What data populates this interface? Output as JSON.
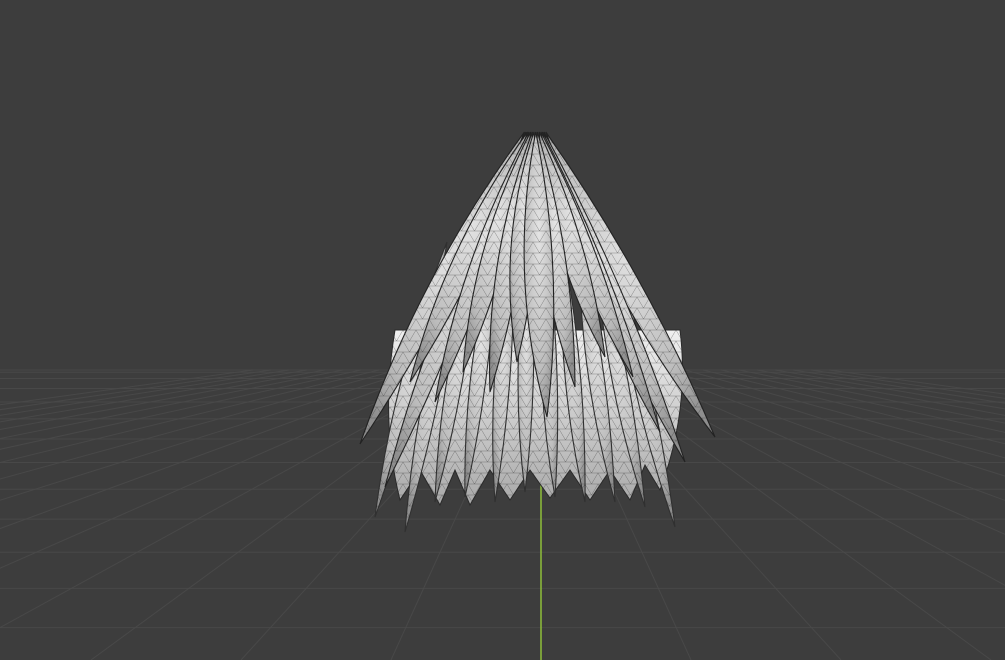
{
  "viewport": {
    "view": "perspective",
    "shading": "solid-wireframe-overlay",
    "background_color": "#3d3d3d",
    "grid_color": "#4a4a4a",
    "y_axis_color": "#8ab83a"
  },
  "object": {
    "kind": "hair-mesh",
    "icon": "mesh-icon",
    "fill_color": "#cfcfcf",
    "wire_color": "#222222"
  }
}
